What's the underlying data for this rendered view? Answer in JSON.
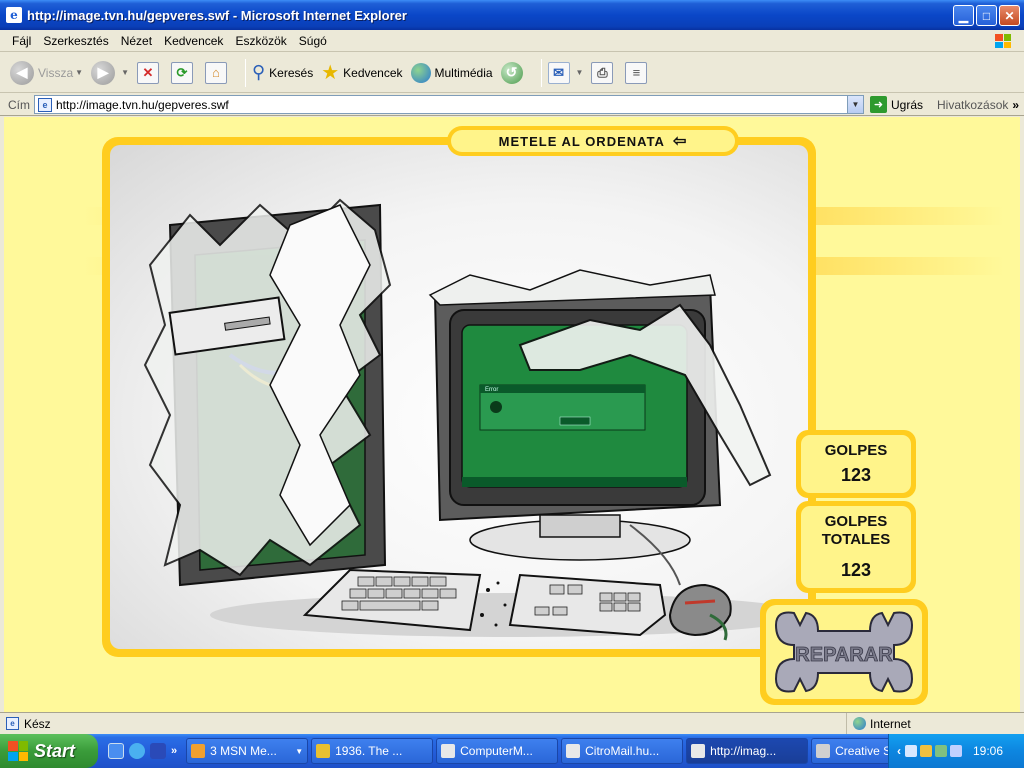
{
  "window": {
    "title": "http://image.tvn.hu/gepveres.swf - Microsoft Internet Explorer"
  },
  "menu": {
    "items": [
      "Fájl",
      "Szerkesztés",
      "Nézet",
      "Kedvencek",
      "Eszközök",
      "Súgó"
    ]
  },
  "toolbar": {
    "back_label": "Vissza",
    "search_label": "Keresés",
    "favorites_label": "Kedvencek",
    "media_label": "Multimédia"
  },
  "address": {
    "label": "Cím",
    "url": "http://image.tvn.hu/gepveres.swf",
    "go_label": "Ugrás",
    "links_label": "Hivatkozások"
  },
  "game": {
    "title": "METELE AL ORDENATA",
    "hits_label": "GOLPES",
    "hits_value": "123",
    "total_label_line1": "GOLPES",
    "total_label_line2": "TOTALES",
    "total_value": "123",
    "repair_label": "REPARAR",
    "screen_dialog_text": "Error"
  },
  "status": {
    "text": "Kész",
    "zone": "Internet"
  },
  "taskbar": {
    "start_label": "Start",
    "tasks": [
      {
        "label": "3 MSN Me...",
        "active": false
      },
      {
        "label": "1936. The ...",
        "active": false
      },
      {
        "label": "ComputerM...",
        "active": false
      },
      {
        "label": "CitroMail.hu...",
        "active": false
      },
      {
        "label": "http://imag...",
        "active": true
      },
      {
        "label": "Creative Su...",
        "active": false
      }
    ],
    "clock": "19:06"
  },
  "colors": {
    "accent_yellow": "#ffcd1f",
    "panel_yellow": "#fff48a",
    "background_yellow": "#fff99a",
    "xp_blue": "#245edb",
    "start_green": "#3a9c3a"
  }
}
